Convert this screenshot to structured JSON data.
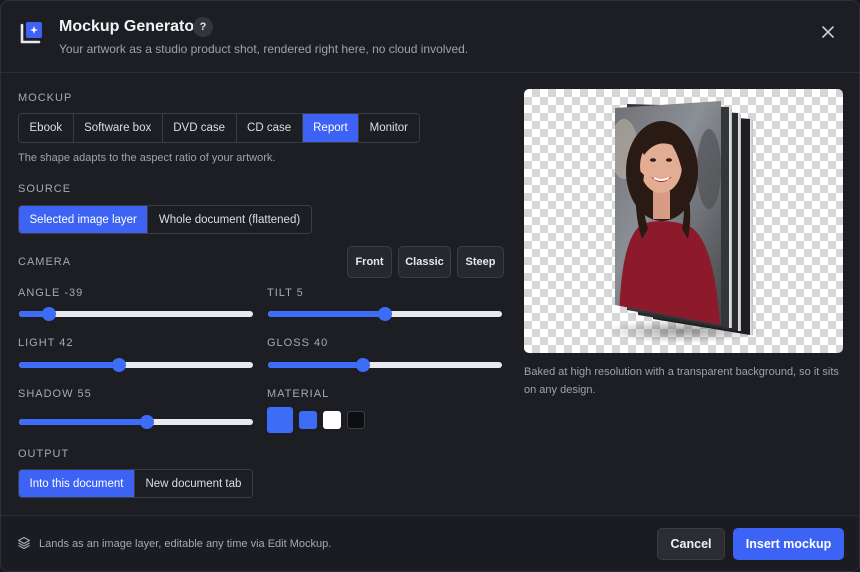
{
  "header": {
    "title": "Mockup Generator",
    "help_label": "?",
    "subtitle": "Your artwork as a studio product shot, rendered right here, no cloud involved.",
    "icon": "mockup-frame-icon",
    "close_icon": "close-icon"
  },
  "mockup": {
    "label": "MOCKUP",
    "options": [
      "Ebook",
      "Software box",
      "DVD case",
      "CD case",
      "Report",
      "Monitor"
    ],
    "selected": "Report",
    "hint": "The shape adapts to the aspect ratio of your artwork."
  },
  "source": {
    "label": "SOURCE",
    "options": [
      "Selected image layer",
      "Whole document (flattened)"
    ],
    "selected": "Selected image layer"
  },
  "camera": {
    "label": "CAMERA",
    "presets": [
      "Front",
      "Classic",
      "Steep"
    ]
  },
  "sliders": {
    "angle": {
      "label": "ANGLE -39",
      "fraction": 0.1
    },
    "tilt": {
      "label": "TILT 5",
      "fraction": 0.5
    },
    "light": {
      "label": "LIGHT 42",
      "fraction": 0.42
    },
    "gloss": {
      "label": "GLOSS 40",
      "fraction": 0.4
    },
    "shadow": {
      "label": "SHADOW 55",
      "fraction": 0.55
    }
  },
  "material": {
    "label": "MATERIAL",
    "colors": [
      "#3d6cf7",
      "#3d6cf7",
      "#ffffff",
      "#0d0e10"
    ],
    "selected_index": 0
  },
  "output": {
    "label": "OUTPUT",
    "options": [
      "Into this document",
      "New document tab"
    ],
    "selected": "Into this document"
  },
  "preview": {
    "caption": "Baked at high resolution with a transparent background, so it sits on any design.",
    "background": "checkerboard"
  },
  "footer": {
    "icon": "layers-icon",
    "text": "Lands as an image layer, editable any time via Edit Mockup.",
    "cancel_label": "Cancel",
    "insert_label": "Insert mockup"
  },
  "colors": {
    "accent": "#3d63f5",
    "background": "#1d1e23"
  }
}
